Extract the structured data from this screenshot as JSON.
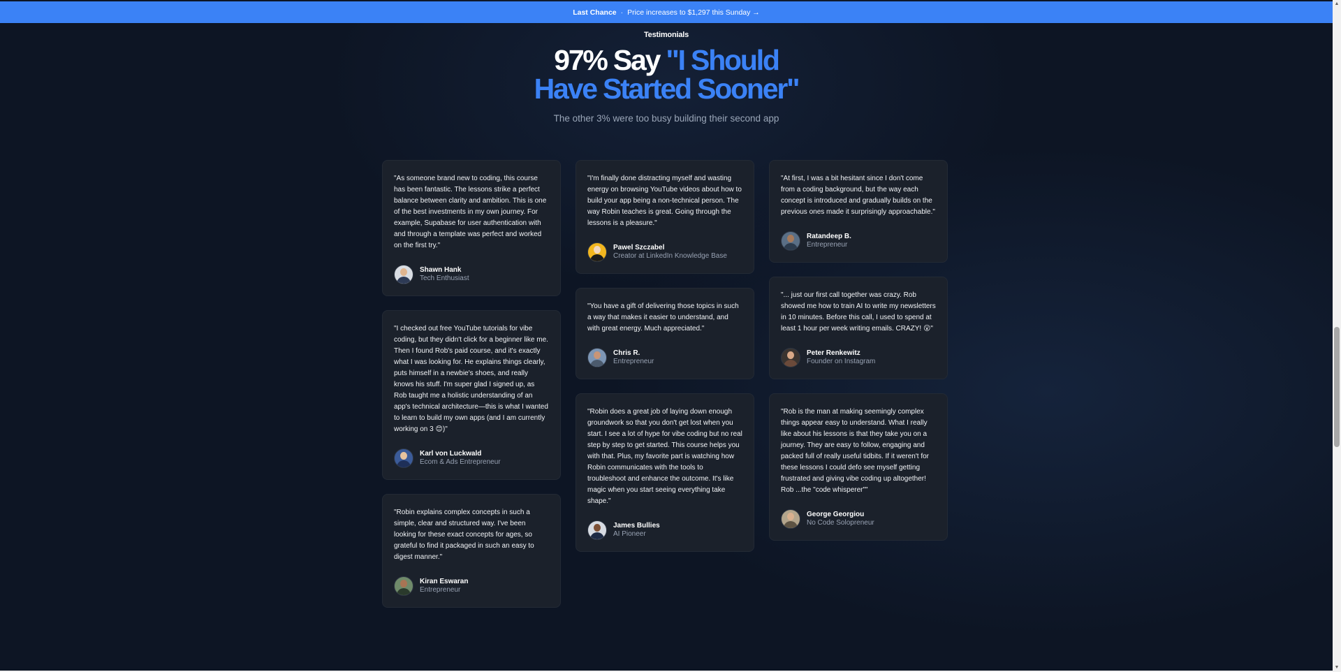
{
  "banner": {
    "label": "Last Chance",
    "separator": "·",
    "message": "Price increases to $1,297 this Sunday →"
  },
  "header": {
    "eyebrow": "Testimonials",
    "title_white": "97% Say ",
    "title_blue_line1": "\"I Should",
    "title_blue_line2": "Have Started Sooner\"",
    "subtitle": "The other 3% were too busy building their second app"
  },
  "testimonials": [
    {
      "quote": "\"As someone brand new to coding, this course has been fantastic. The lessons strike a perfect balance between clarity and ambition. This is one of the best investments in my own journey. For example, Supabase for user authentication with and through a template was perfect and worked on the first try.\"",
      "name": "Shawn Hank",
      "role": "Tech Enthusiast"
    },
    {
      "quote": "\"I checked out free YouTube tutorials for vibe coding, but they didn't click for a beginner like me. Then I found Rob's paid course, and it's exactly what I was looking for. He explains things clearly, puts himself in a newbie's shoes, and really knows his stuff. I'm super glad I signed up, as Rob taught me a holistic understanding of an app's technical architecture—this is what I wanted to learn to build my own apps (and I am currently working on 3 😊)\"",
      "name": "Karl von Luckwald",
      "role": "Ecom & Ads Entrepreneur"
    },
    {
      "quote": "\"Robin explains complex concepts in such a simple, clear and structured way. I've been looking for these exact concepts for ages, so grateful to find it packaged in such an easy to digest manner.\"",
      "name": "Kiran Eswaran",
      "role": "Entrepreneur"
    },
    {
      "quote": "\"I'm finally done distracting myself and wasting energy on browsing YouTube videos about how to build your app being a non-technical person. The way Robin teaches is great. Going through the lessons is a pleasure.\"",
      "name": "Pawel Szczabel",
      "role": "Creator at LinkedIn Knowledge Base"
    },
    {
      "quote": "\"You have a gift of delivering those topics in such a way that makes it easier to understand, and with great energy. Much appreciated.\"",
      "name": "Chris R.",
      "role": "Entrepreneur"
    },
    {
      "quote": "\"Robin does a great job of laying down enough groundwork so that you don't get lost when you start. I see a lot of hype for vibe coding but no real step by step to get started. This course helps you with that. Plus, my favorite part is watching how Robin communicates with the tools to troubleshoot and enhance the outcome. It's like magic when you start seeing everything take shape.\"",
      "name": "James Bullies",
      "role": "AI Pioneer"
    },
    {
      "quote": "\"At first, I was a bit hesitant since I don't come from a coding background, but the way each concept is introduced and gradually builds on the previous ones made it surprisingly approachable.\"",
      "name": "Ratandeep B.",
      "role": "Entrepreneur"
    },
    {
      "quote": "\"... just our first call together was crazy. Rob showed me how to train AI to write my newsletters in 10 minutes. Before this call, I used to spend at least 1 hour per week writing emails. CRAZY! 😮\"",
      "name": "Peter Renkewitz",
      "role": "Founder on Instagram"
    },
    {
      "quote": "\"Rob is the man at making seemingly complex things appear easy to understand. What I really like about his lessons is that they take you on a journey. They are easy to follow, engaging and packed full of really useful tidbits. If it weren't for these lessons I could defo see myself getting frustrated and giving vibe coding up altogether! Rob ...the \"code whisperer\"\"",
      "name": "George Georgiou",
      "role": "No Code Solopreneur"
    }
  ],
  "colors": {
    "accent": "#3b82f6",
    "background": "#0d1524",
    "card": "#1b212b"
  }
}
